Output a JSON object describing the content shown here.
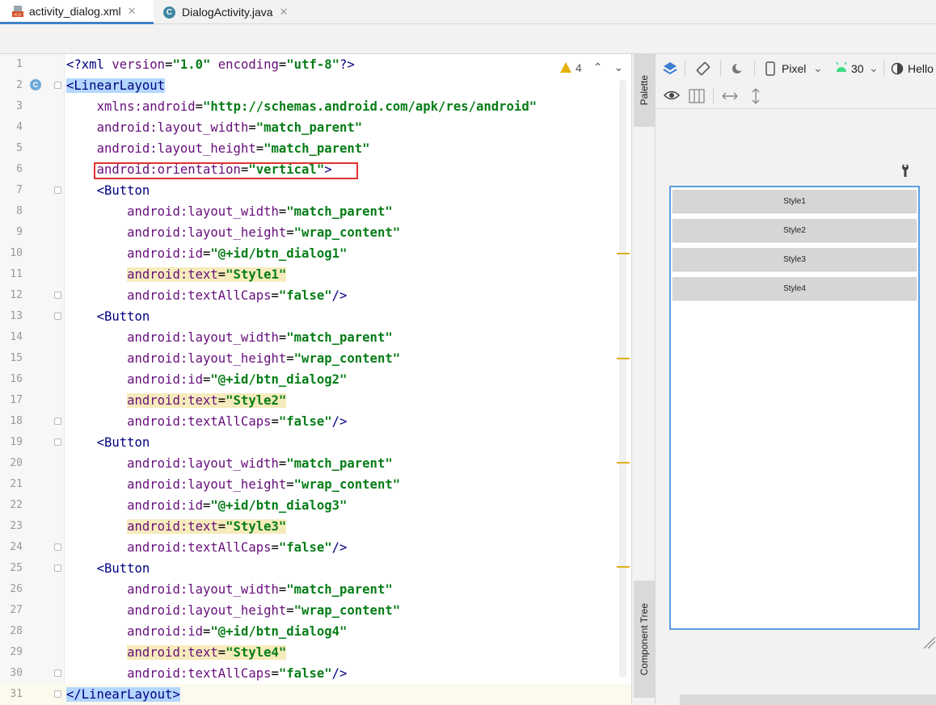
{
  "tabs": [
    {
      "label": "activity_dialog.xml",
      "close": "✕",
      "active": true
    },
    {
      "label": "DialogActivity.java",
      "close": "✕",
      "active": false
    }
  ],
  "editor": {
    "warning_count": "4",
    "lines": [
      {
        "n": "1",
        "indent": "",
        "tokens": [
          {
            "t": "<?xml ",
            "c": "tag"
          },
          {
            "t": "version",
            "c": "attr"
          },
          {
            "t": "=",
            "c": "plain"
          },
          {
            "t": "\"1.0\"",
            "c": "val"
          },
          {
            "t": " ",
            "c": "plain"
          },
          {
            "t": "encoding",
            "c": "attr"
          },
          {
            "t": "=",
            "c": "plain"
          },
          {
            "t": "\"utf-8\"",
            "c": "val"
          },
          {
            "t": "?>",
            "c": "tag"
          }
        ]
      },
      {
        "n": "2",
        "indent": "",
        "tokens": [
          {
            "t": "<LinearLayout",
            "c": "tag tag-hl"
          }
        ]
      },
      {
        "n": "3",
        "indent": "    ",
        "tokens": [
          {
            "t": "xmlns:",
            "c": "ns"
          },
          {
            "t": "android",
            "c": "attr"
          },
          {
            "t": "=",
            "c": "plain"
          },
          {
            "t": "\"http://schemas.android.com/apk/res/android\"",
            "c": "val"
          }
        ]
      },
      {
        "n": "4",
        "indent": "    ",
        "tokens": [
          {
            "t": "android:",
            "c": "ns"
          },
          {
            "t": "layout_width",
            "c": "attr"
          },
          {
            "t": "=",
            "c": "plain"
          },
          {
            "t": "\"match_parent\"",
            "c": "val"
          }
        ]
      },
      {
        "n": "5",
        "indent": "    ",
        "tokens": [
          {
            "t": "android:",
            "c": "ns"
          },
          {
            "t": "layout_height",
            "c": "attr"
          },
          {
            "t": "=",
            "c": "plain"
          },
          {
            "t": "\"match_parent\"",
            "c": "val"
          }
        ]
      },
      {
        "n": "6",
        "indent": "    ",
        "tokens": [
          {
            "t": "android:",
            "c": "ns"
          },
          {
            "t": "orientation",
            "c": "attr"
          },
          {
            "t": "=",
            "c": "plain"
          },
          {
            "t": "\"vertical\"",
            "c": "val"
          },
          {
            "t": ">",
            "c": "tag"
          }
        ]
      },
      {
        "n": "7",
        "indent": "    ",
        "tokens": [
          {
            "t": "<Button",
            "c": "tag"
          }
        ]
      },
      {
        "n": "8",
        "indent": "        ",
        "tokens": [
          {
            "t": "android:",
            "c": "ns"
          },
          {
            "t": "layout_width",
            "c": "attr"
          },
          {
            "t": "=",
            "c": "plain"
          },
          {
            "t": "\"match_parent\"",
            "c": "val"
          }
        ]
      },
      {
        "n": "9",
        "indent": "        ",
        "tokens": [
          {
            "t": "android:",
            "c": "ns"
          },
          {
            "t": "layout_height",
            "c": "attr"
          },
          {
            "t": "=",
            "c": "plain"
          },
          {
            "t": "\"wrap_content\"",
            "c": "val"
          }
        ]
      },
      {
        "n": "10",
        "indent": "        ",
        "tokens": [
          {
            "t": "android:",
            "c": "ns"
          },
          {
            "t": "id",
            "c": "attr"
          },
          {
            "t": "=",
            "c": "plain"
          },
          {
            "t": "\"@+id/btn_dialog1\"",
            "c": "val"
          }
        ]
      },
      {
        "n": "11",
        "indent": "        ",
        "tokens": [
          {
            "t": "android:",
            "c": "ns hl-text"
          },
          {
            "t": "text",
            "c": "attr hl-text"
          },
          {
            "t": "=",
            "c": "plain hl-text"
          },
          {
            "t": "\"Style1\"",
            "c": "val hl-text"
          }
        ]
      },
      {
        "n": "12",
        "indent": "        ",
        "tokens": [
          {
            "t": "android:",
            "c": "ns"
          },
          {
            "t": "textAllCaps",
            "c": "attr"
          },
          {
            "t": "=",
            "c": "plain"
          },
          {
            "t": "\"false\"",
            "c": "val"
          },
          {
            "t": "/>",
            "c": "tag"
          }
        ]
      },
      {
        "n": "13",
        "indent": "    ",
        "tokens": [
          {
            "t": "<Button",
            "c": "tag"
          }
        ]
      },
      {
        "n": "14",
        "indent": "        ",
        "tokens": [
          {
            "t": "android:",
            "c": "ns"
          },
          {
            "t": "layout_width",
            "c": "attr"
          },
          {
            "t": "=",
            "c": "plain"
          },
          {
            "t": "\"match_parent\"",
            "c": "val"
          }
        ]
      },
      {
        "n": "15",
        "indent": "        ",
        "tokens": [
          {
            "t": "android:",
            "c": "ns"
          },
          {
            "t": "layout_height",
            "c": "attr"
          },
          {
            "t": "=",
            "c": "plain"
          },
          {
            "t": "\"wrap_content\"",
            "c": "val"
          }
        ]
      },
      {
        "n": "16",
        "indent": "        ",
        "tokens": [
          {
            "t": "android:",
            "c": "ns"
          },
          {
            "t": "id",
            "c": "attr"
          },
          {
            "t": "=",
            "c": "plain"
          },
          {
            "t": "\"@+id/btn_dialog2\"",
            "c": "val"
          }
        ]
      },
      {
        "n": "17",
        "indent": "        ",
        "tokens": [
          {
            "t": "android:",
            "c": "ns hl-text"
          },
          {
            "t": "text",
            "c": "attr hl-text"
          },
          {
            "t": "=",
            "c": "plain hl-text"
          },
          {
            "t": "\"Style2\"",
            "c": "val hl-text"
          }
        ]
      },
      {
        "n": "18",
        "indent": "        ",
        "tokens": [
          {
            "t": "android:",
            "c": "ns"
          },
          {
            "t": "textAllCaps",
            "c": "attr"
          },
          {
            "t": "=",
            "c": "plain"
          },
          {
            "t": "\"false\"",
            "c": "val"
          },
          {
            "t": "/>",
            "c": "tag"
          }
        ]
      },
      {
        "n": "19",
        "indent": "    ",
        "tokens": [
          {
            "t": "<Button",
            "c": "tag"
          }
        ]
      },
      {
        "n": "20",
        "indent": "        ",
        "tokens": [
          {
            "t": "android:",
            "c": "ns"
          },
          {
            "t": "layout_width",
            "c": "attr"
          },
          {
            "t": "=",
            "c": "plain"
          },
          {
            "t": "\"match_parent\"",
            "c": "val"
          }
        ]
      },
      {
        "n": "21",
        "indent": "        ",
        "tokens": [
          {
            "t": "android:",
            "c": "ns"
          },
          {
            "t": "layout_height",
            "c": "attr"
          },
          {
            "t": "=",
            "c": "plain"
          },
          {
            "t": "\"wrap_content\"",
            "c": "val"
          }
        ]
      },
      {
        "n": "22",
        "indent": "        ",
        "tokens": [
          {
            "t": "android:",
            "c": "ns"
          },
          {
            "t": "id",
            "c": "attr"
          },
          {
            "t": "=",
            "c": "plain"
          },
          {
            "t": "\"@+id/btn_dialog3\"",
            "c": "val"
          }
        ]
      },
      {
        "n": "23",
        "indent": "        ",
        "tokens": [
          {
            "t": "android:",
            "c": "ns hl-text"
          },
          {
            "t": "text",
            "c": "attr hl-text"
          },
          {
            "t": "=",
            "c": "plain hl-text"
          },
          {
            "t": "\"Style3\"",
            "c": "val hl-text"
          }
        ]
      },
      {
        "n": "24",
        "indent": "        ",
        "tokens": [
          {
            "t": "android:",
            "c": "ns"
          },
          {
            "t": "textAllCaps",
            "c": "attr"
          },
          {
            "t": "=",
            "c": "plain"
          },
          {
            "t": "\"false\"",
            "c": "val"
          },
          {
            "t": "/>",
            "c": "tag"
          }
        ]
      },
      {
        "n": "25",
        "indent": "    ",
        "tokens": [
          {
            "t": "<Button",
            "c": "tag"
          }
        ]
      },
      {
        "n": "26",
        "indent": "        ",
        "tokens": [
          {
            "t": "android:",
            "c": "ns"
          },
          {
            "t": "layout_width",
            "c": "attr"
          },
          {
            "t": "=",
            "c": "plain"
          },
          {
            "t": "\"match_parent\"",
            "c": "val"
          }
        ]
      },
      {
        "n": "27",
        "indent": "        ",
        "tokens": [
          {
            "t": "android:",
            "c": "ns"
          },
          {
            "t": "layout_height",
            "c": "attr"
          },
          {
            "t": "=",
            "c": "plain"
          },
          {
            "t": "\"wrap_content\"",
            "c": "val"
          }
        ]
      },
      {
        "n": "28",
        "indent": "        ",
        "tokens": [
          {
            "t": "android:",
            "c": "ns"
          },
          {
            "t": "id",
            "c": "attr"
          },
          {
            "t": "=",
            "c": "plain"
          },
          {
            "t": "\"@+id/btn_dialog4\"",
            "c": "val"
          }
        ]
      },
      {
        "n": "29",
        "indent": "        ",
        "tokens": [
          {
            "t": "android:",
            "c": "ns hl-text"
          },
          {
            "t": "text",
            "c": "attr hl-text"
          },
          {
            "t": "=",
            "c": "plain hl-text"
          },
          {
            "t": "\"Style4\"",
            "c": "val hl-text"
          }
        ]
      },
      {
        "n": "30",
        "indent": "        ",
        "tokens": [
          {
            "t": "android:",
            "c": "ns"
          },
          {
            "t": "textAllCaps",
            "c": "attr"
          },
          {
            "t": "=",
            "c": "plain"
          },
          {
            "t": "\"false\"",
            "c": "val"
          },
          {
            "t": "/>",
            "c": "tag"
          }
        ]
      },
      {
        "n": "31",
        "indent": "",
        "tokens": [
          {
            "t": "</LinearLayout",
            "c": "tag tag-hl"
          },
          {
            "t": ">",
            "c": "tag tag-hl"
          }
        ]
      }
    ]
  },
  "side_panels": {
    "palette": "Palette",
    "component_tree": "Component Tree"
  },
  "design_toolbar": {
    "device": "Pixel",
    "api_level": "30",
    "theme": "Hello"
  },
  "preview": {
    "buttons": [
      "Style1",
      "Style2",
      "Style3",
      "Style4"
    ]
  },
  "colors": {
    "accent": "#4083c9",
    "highlight_box": "#e0322f",
    "warning": "#e4b100"
  }
}
